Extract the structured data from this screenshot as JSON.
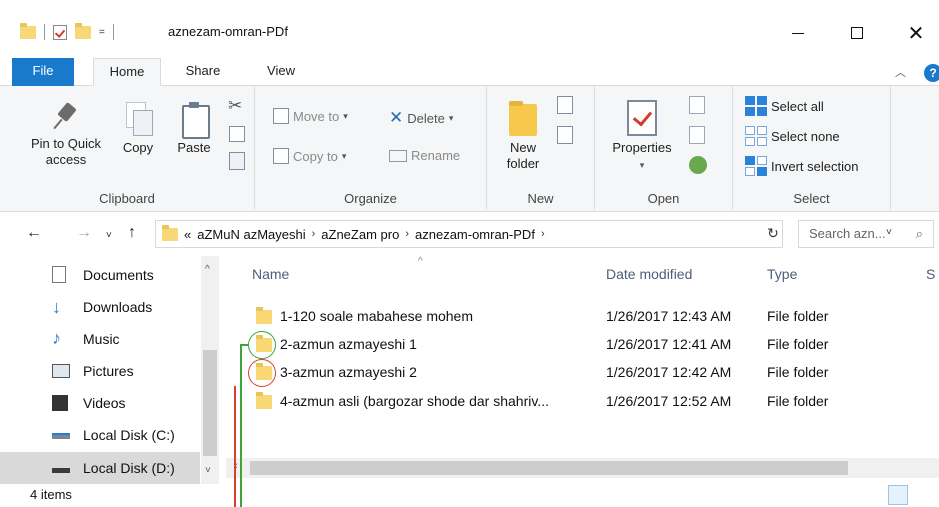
{
  "window": {
    "title": "aznezam-omran-PDf",
    "qat_arrow": "="
  },
  "tabs": [
    {
      "label": "File"
    },
    {
      "label": "Home"
    },
    {
      "label": "Share"
    },
    {
      "label": "View"
    }
  ],
  "ribbon": {
    "clipboard": {
      "pin_label": "Pin to Quick access",
      "copy_label": "Copy",
      "paste_label": "Paste",
      "group_label": "Clipboard"
    },
    "organize": {
      "move_to": "Move to",
      "copy_to": "Copy to",
      "delete": "Delete",
      "rename": "Rename",
      "group_label": "Organize"
    },
    "new": {
      "new_folder": "New folder",
      "group_label": "New"
    },
    "open": {
      "properties": "Properties",
      "group_label": "Open"
    },
    "select": {
      "select_all": "Select all",
      "select_none": "Select none",
      "invert": "Invert selection",
      "group_label": "Select"
    }
  },
  "address": {
    "overflow": "«",
    "crumbs": [
      "aZMuN azMayeshi",
      "aZneZam pro",
      "aznezam-omran-PDf"
    ],
    "search_placeholder": "Search azn..."
  },
  "nav_pane": {
    "items": [
      {
        "label": "Documents",
        "icon": "documents-icon"
      },
      {
        "label": "Downloads",
        "icon": "downloads-icon"
      },
      {
        "label": "Music",
        "icon": "music-icon"
      },
      {
        "label": "Pictures",
        "icon": "pictures-icon"
      },
      {
        "label": "Videos",
        "icon": "videos-icon"
      },
      {
        "label": "Local Disk (C:)",
        "icon": "drive-icon"
      },
      {
        "label": "Local Disk (D:)",
        "icon": "drive-icon",
        "selected": true
      }
    ]
  },
  "file_list": {
    "columns": {
      "name": "Name",
      "date": "Date modified",
      "type": "Type",
      "size_partial": "S"
    },
    "rows": [
      {
        "name": "1-120 soale mabahese mohem",
        "date": "1/26/2017 12:43 AM",
        "type": "File folder"
      },
      {
        "name": "2-azmun azmayeshi 1",
        "date": "1/26/2017 12:41 AM",
        "type": "File folder"
      },
      {
        "name": "3-azmun azmayeshi 2",
        "date": "1/26/2017 12:42 AM",
        "type": "File folder"
      },
      {
        "name": "4-azmun asli (bargozar shode dar shahriv...",
        "date": "1/26/2017 12:52 AM",
        "type": "File folder"
      }
    ]
  },
  "status": {
    "items_count": "4 items"
  },
  "colors": {
    "accent": "#1979ca",
    "folder": "#f8d874",
    "annotation_green": "#3aa63a",
    "annotation_red": "#d9402a"
  }
}
